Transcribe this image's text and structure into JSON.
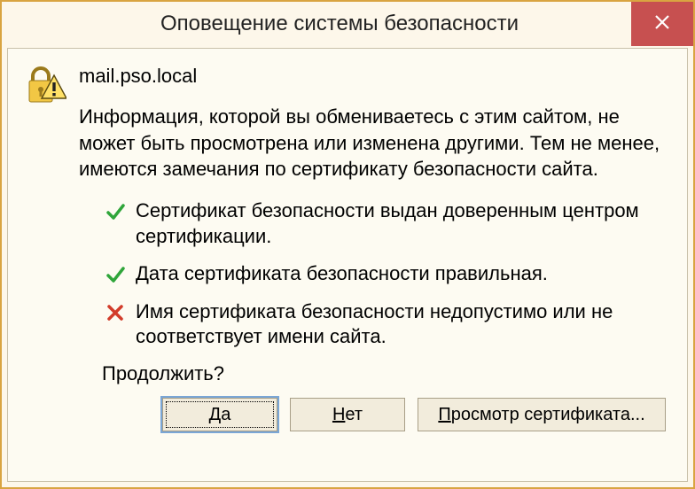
{
  "titlebar": {
    "title": "Оповещение системы безопасности"
  },
  "body": {
    "hostname": "mail.pso.local",
    "description": "Информация, которой вы обмениваетесь с этим сайтом, не может быть просмотрена или изменена другими. Тем не менее, имеются замечания по сертификату безопасности сайта.",
    "checks": [
      {
        "status": "ok",
        "text": "Сертификат безопасности выдан доверенным центром сертификации."
      },
      {
        "status": "ok",
        "text": "Дата сертификата безопасности правильная."
      },
      {
        "status": "fail",
        "text": "Имя сертификата безопасности недопустимо или не соответствует имени сайта."
      }
    ],
    "continue_prompt": "Продолжить?"
  },
  "buttons": {
    "yes_pre": "Д",
    "yes_ul": "а",
    "no_pre": "",
    "no_ul": "Н",
    "no_post": "ет",
    "view_pre": "",
    "view_ul": "П",
    "view_post": "росмотр сертификата..."
  }
}
